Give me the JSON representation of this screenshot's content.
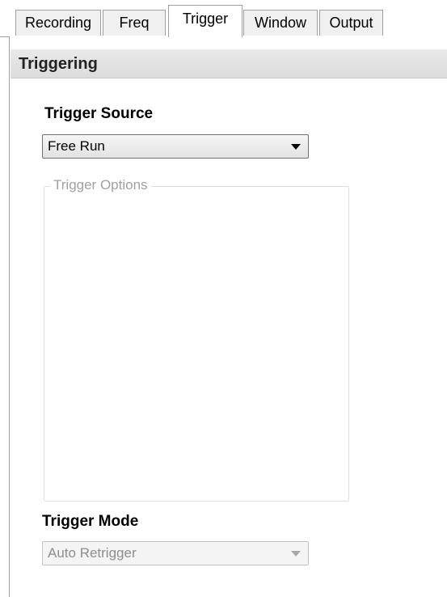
{
  "tabs": [
    {
      "label": "Recording",
      "active": false
    },
    {
      "label": "Freq",
      "active": false
    },
    {
      "label": "Trigger",
      "active": true
    },
    {
      "label": "Window",
      "active": false
    },
    {
      "label": "Output",
      "active": false
    }
  ],
  "section": {
    "title": "Triggering"
  },
  "trigger_source": {
    "label": "Trigger Source",
    "value": "Free Run",
    "enabled": true
  },
  "trigger_options": {
    "title": "Trigger Options",
    "enabled": false
  },
  "trigger_mode": {
    "label": "Trigger Mode",
    "value": "Auto Retrigger",
    "enabled": false
  },
  "colors": {
    "border": "#a0a0a0",
    "disabled_text": "#8d8d8d",
    "header_bg": "#e2e2e2"
  },
  "icons": {
    "dropdown": "chevron-down-icon"
  }
}
